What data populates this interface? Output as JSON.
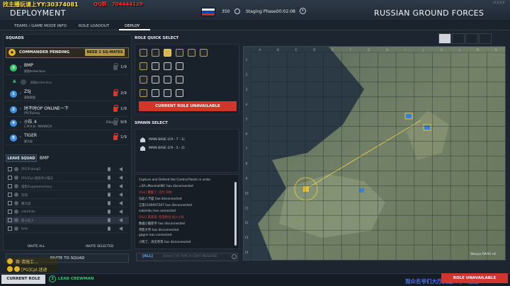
{
  "overlay": {
    "stream_text": "找主播玩请上YY:30374081",
    "qq_text": "QQ群：704444129",
    "follow_text": "观众名爷们大厅关注一下~谢谢"
  },
  "header": {
    "title": "DEPLOYMENT",
    "tickets": "350",
    "phase_label": "Staging Phase:",
    "phase_time": "00:02:08",
    "faction": "RUSSIAN GROUND FORCES",
    "version": "v1.0.0.0",
    "flag_colors": [
      "#ffffff",
      "#1c3fae",
      "#d52b1e"
    ]
  },
  "nav": {
    "tabs": [
      "TEAMS / GAME MODE INFO",
      "ROLE LOADOUT",
      "DEPLOY"
    ],
    "active": "DEPLOY"
  },
  "squads": {
    "title": "SQUADS",
    "commander_label": "COMMANDER PENDING",
    "commander_warning": "NEED 2 SQ-MATES",
    "list": [
      {
        "num": "3",
        "name": "BMP",
        "leader": "赛脂brokenlove",
        "count": "1/9",
        "num_color": "#32c765",
        "locked": false,
        "full": ""
      },
      {
        "num": "1",
        "name": "ZSJ",
        "leader": "赛脂赛脂",
        "count": "2/9",
        "num_color": "#3f8fe0",
        "locked": true,
        "full": ""
      },
      {
        "num": "2",
        "name": "时不时OP ONLINE一下",
        "leader": "[PG]Fulong",
        "count": "1/9",
        "num_color": "#3f8fe0",
        "locked": true,
        "full": ""
      },
      {
        "num": "4",
        "name": "小队 4",
        "leader": "C.M.A.N - MAYBACH",
        "count": "9/9",
        "num_color": "#3f8fe0",
        "locked": false,
        "full": "FULL"
      },
      {
        "num": "5",
        "name": "TIGER",
        "leader": "赛大鼠",
        "count": "1/9",
        "num_color": "#3f8fe0",
        "locked": true,
        "full": ""
      }
    ],
    "member": {
      "role": "A",
      "name": "赛脂brokenlove"
    },
    "leave_label": "LEAVE SQUAD",
    "my_squad": "BMP",
    "players": [
      "[PG]Fulong1",
      "[PG]Cpl.迷途的小猫头",
      "猎影Supplementary",
      "泡泡",
      "赛大鼠",
      "sakimiku",
      "彦斗狂人",
      "lpqn"
    ],
    "invite_all": "INVITE ALL",
    "invite_selected": "INVITE SELECTED",
    "invite_to_squad": "INVITE TO SQUAD",
    "chat_overlay_1": "赛·请施工...",
    "chat_overlay_2": "[PG]Cpl.迷途"
  },
  "role_select": {
    "title": "ROLE QUICK SELECT",
    "unavailable": "CURRENT ROLE UNAVAILABLE"
  },
  "spawn": {
    "title": "SPAWN SELECT",
    "items": [
      "MAIN BASE (C9 - 7 - 1)",
      "MAIN BASE (C9 - 3 - 2)"
    ]
  },
  "chat": {
    "lines": [
      {
        "text": "Capture and Defend the Control Points in order.",
        "red": false
      },
      {
        "text": "=SP=MarshalllBC has disconnected",
        "red": false
      },
      {
        "text": "[ALL] 聚集了: 自行 开始",
        "red": true
      },
      {
        "text": "乐此人予盛 has disconnected",
        "red": false
      },
      {
        "text": "江南1109097267 has disconnected",
        "red": false
      },
      {
        "text": "sakimiku has connected",
        "red": false
      },
      {
        "text": "[ALL] 某某某: 欢迎各位 加入小队",
        "red": true
      },
      {
        "text": "数据小酷新手 has disconnected",
        "red": false
      },
      {
        "text": "带影大爷 has disconnected",
        "red": false
      },
      {
        "text": "gagnn has connected",
        "red": false
      },
      {
        "text": "小熊丁，再见吧哥 has disconnected",
        "red": false
      }
    ],
    "channel": "[ALL]",
    "placeholder": "[Enter] TO TYPE A CHAT MESSAGE"
  },
  "map": {
    "columns": [
      "A",
      "B",
      "C",
      "D",
      "E",
      "F",
      "G",
      "H",
      "I",
      "J",
      "K",
      "L",
      "M",
      "N"
    ],
    "rows": [
      "1",
      "2",
      "3",
      "4",
      "5",
      "6",
      "7",
      "8",
      "9",
      "10",
      "11",
      "12",
      "13",
      "14"
    ],
    "scale": "Skorpo RAAS v4",
    "tool_icons": [
      "chat-icon",
      "role-icon",
      "squad-icon",
      "vehicle-icon"
    ]
  },
  "bottom": {
    "current_role": "CURRENT ROLE",
    "role_badge": "3",
    "role_name": "LEAD CREWMAN",
    "role_unavailable": "ROLE UNAVAILABLE"
  }
}
